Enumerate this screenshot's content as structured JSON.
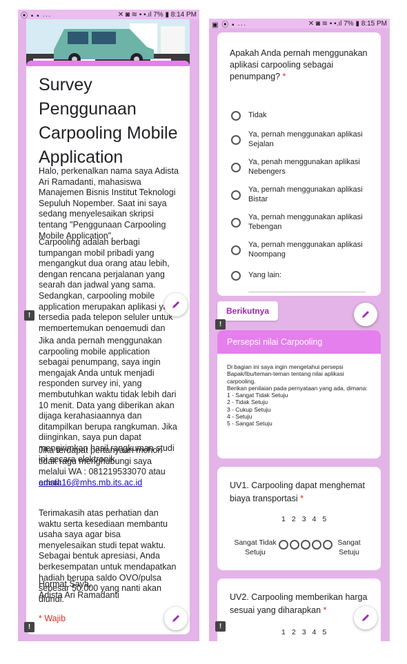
{
  "left_top": {
    "status": {
      "icons": "⦿ ▪ ▪ ···",
      "right": "✕ ◙ ≋ ▪ ▪.ıl 7% ▮ 8:14 PM"
    },
    "title": "Survey Penggunaan Carpooling Mobile Application",
    "p1": "Halo, perkenalkan nama saya Adista Ari Ramadanti, mahasiswa Manajemen Bisnis Institut Teknologi Sepuluh Nopember. Saat ini saya sedang menyelesaikan skripsi tentang \"Penggunaan Carpooling Mobile Application\".",
    "p2": "Carpooling adalah berbagi tumpangan mobil pribadi yang mengangkut dua orang atau lebih, dengan rencana perjalanan yang searah dan jadwal yang sama. Sedangkan, carpooling mobile application merupakan aplikasi yang tersedia pada telepon seluler untuk mempertemukan pengemudi dan beberapa penumpang dengan tujuan dan jadwal yang sama."
  },
  "left_bottom": {
    "p3": "Jika anda pernah menggunakan carpooling mobile application sebagai penumpang, saya ingin mengajak Anda untuk menjadi responden survey ini, yang membutuhkan waktu tidak lebih dari 10 menit. Data yang diberikan akan dijaga kerahasiaannya dan ditampilkan berupa rangkuman. Jika diinginkan, saya pun dapat mengirimkan hasil rangkuman studi ini secara elektronik.",
    "p4": "Jika terdapat pertanyaan mohon tidak ragu menghubungi saya melalui WA : 081219533070 atau email:",
    "email": "adista16@mhs.mb.its.ac.id",
    "p5": "Terimakasih atas perhatian dan waktu serta kesediaan membantu usaha saya agar bisa menyelesaikan studi tepat waktu. Sebagai bentuk apresiasi, Anda berkesempatan untuk mendapatkan hadiah berupa saldo OVO/pulsa sebesar 50.000 yang nanti akan diundi.",
    "p6a": "Hormat Saya,",
    "p6b": "Adista Ari Ramadanti",
    "required": "* Wajib"
  },
  "right_top": {
    "status": {
      "icons": "▣ ⦿ ▪ ···",
      "right": "✕ ◙ ≋ ▪ ▪.ıl 7% ▮ 8:15 PM"
    },
    "question": "Apakah Anda pernah menggunakan aplikasi carpooling sebagai penumpang?",
    "asterisk": "*",
    "options": [
      "Tidak",
      "Ya, pernah menggunakan aplikasi Sejalan",
      "Ya, penah menggunakan aplikasi Nebengers",
      "Ya, pernah menggunakan aplikasi Bistar",
      "Ya, pernah menggunakan aplikasi Tebengan",
      "Ya, pernah menggunakan aplikasi Noompang",
      "Yang lain:"
    ],
    "next": "Berikutnya"
  },
  "right_bottom": {
    "section_title": "Persepsi nilai Carpooling",
    "desc": [
      "Di bagian ini saya ingin mengetahui persepsi Bapak/Ibu/teman-teman tentang nilai aplikasi carpooling.",
      "Berikan penilaian pada pernyataan yang ada, dimana:",
      "1 - Sangat Tidak Setuju",
      "2 - Tidak Setuju",
      "3 - Cukup Setuju",
      "4 - Setuju",
      "5 - Sangat Setuju"
    ],
    "q1": "UV1. Carpooling dapat menghemat biaya transportasi",
    "q2": "UV2. Carpooling memberikan harga sesuai yang diharapkan",
    "asterisk": "*",
    "scale": [
      "1",
      "2",
      "3",
      "4",
      "5"
    ],
    "low": "Sangat Tidak Setuju",
    "high": "Sangat Setuju"
  },
  "flag": "!",
  "colors": {
    "accent": "#e57fed",
    "bg": "#e4b3e8",
    "required": "#d93025",
    "link": "#1a0dab",
    "next": "#9c27b0"
  }
}
